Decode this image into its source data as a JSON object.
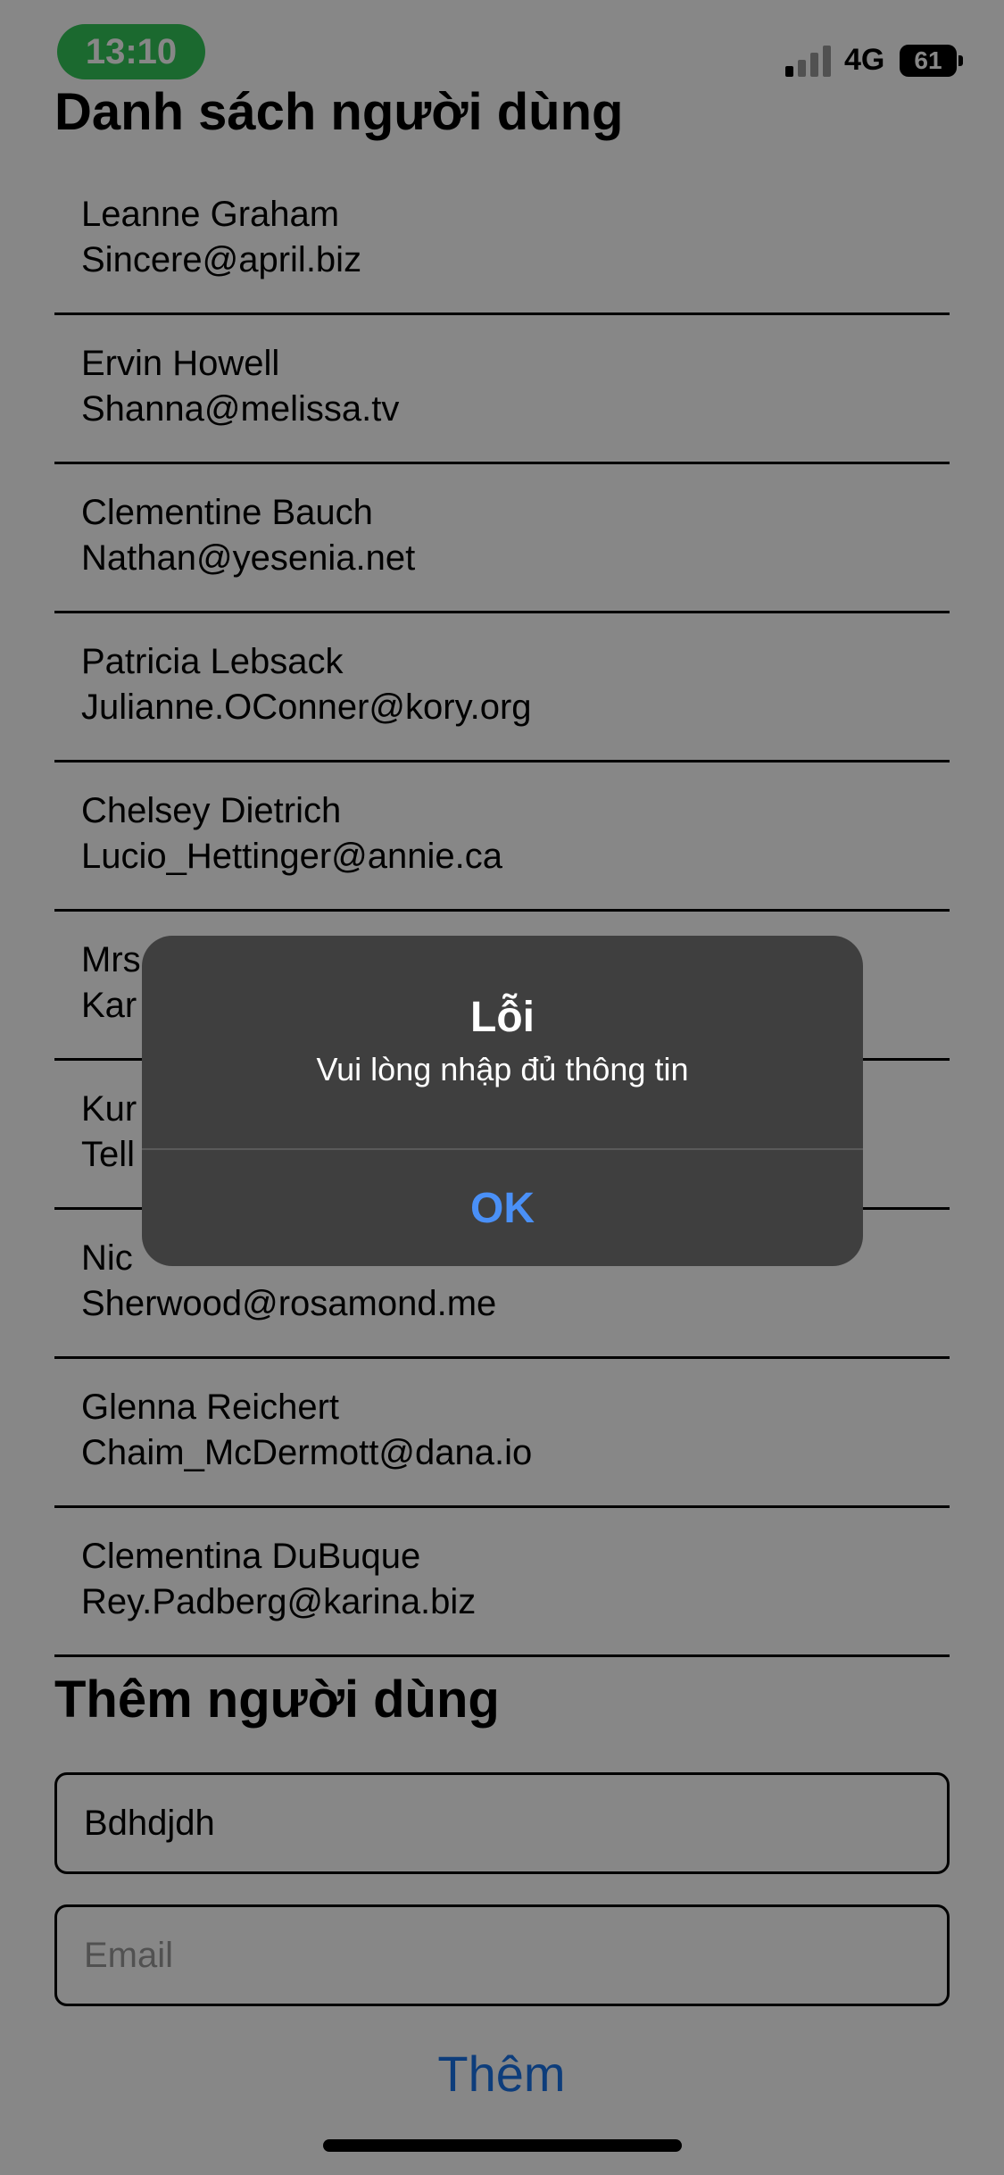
{
  "status_bar": {
    "time": "13:10",
    "network": "4G",
    "battery": "61",
    "signal_icon": "signal-bars-icon",
    "battery_icon": "battery-icon"
  },
  "user_list": {
    "title": "Danh sách người dùng",
    "users": [
      {
        "name": "Leanne Graham",
        "email": "Sincere@april.biz"
      },
      {
        "name": "Ervin Howell",
        "email": "Shanna@melissa.tv"
      },
      {
        "name": "Clementine Bauch",
        "email": "Nathan@yesenia.net"
      },
      {
        "name": "Patricia Lebsack",
        "email": "Julianne.OConner@kory.org"
      },
      {
        "name": "Chelsey Dietrich",
        "email": "Lucio_Hettinger@annie.ca"
      },
      {
        "name": "Mrs",
        "email": "Kar"
      },
      {
        "name": "Kur",
        "email": "Tell"
      },
      {
        "name": "Nic",
        "email": "Sherwood@rosamond.me"
      },
      {
        "name": "Glenna Reichert",
        "email": "Chaim_McDermott@dana.io"
      },
      {
        "name": "Clementina DuBuque",
        "email": "Rey.Padberg@karina.biz"
      }
    ]
  },
  "add_user": {
    "title": "Thêm người dùng",
    "name_value": "Bdhdjdh",
    "email_placeholder": "Email",
    "submit_label": "Thêm"
  },
  "alert": {
    "title": "Lỗi",
    "message": "Vui lòng nhập đủ thông tin",
    "ok_label": "OK"
  },
  "colors": {
    "status_pill": "#34c759",
    "accent": "#1a73e8",
    "alert_background": "#3f3f3f",
    "alert_button": "#4a90f7"
  }
}
